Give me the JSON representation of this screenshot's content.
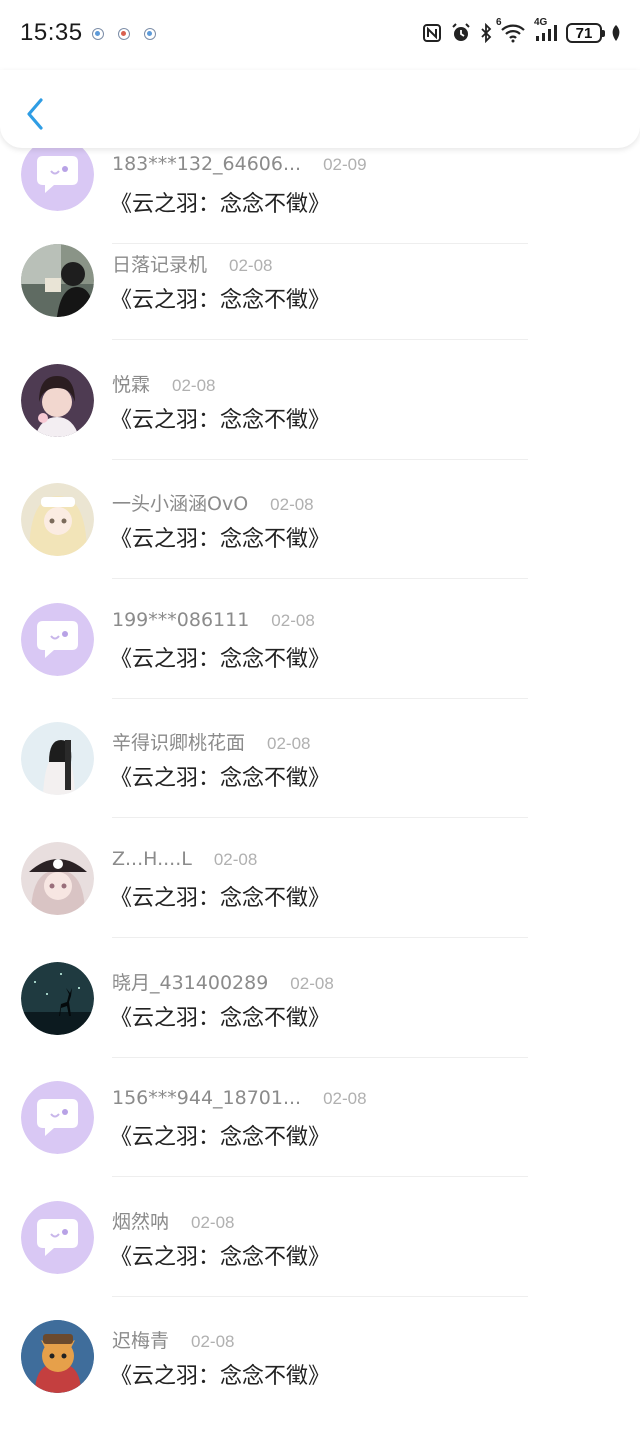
{
  "status_bar": {
    "time": "15:35",
    "network_label": "4G",
    "wifi_badge": "6",
    "battery": "71"
  },
  "header": {
    "back_icon": "chevron-left-icon",
    "accent_color": "#2f9de4"
  },
  "comments": [
    {
      "name": "183***132_64606...",
      "date": "02-09",
      "text": "《云之羽：念念不徵》",
      "avatar": "default-bubble"
    },
    {
      "name": "日落记录机",
      "date": "02-08",
      "text": "《云之羽：念念不徵》",
      "avatar": "photo-reading-girl"
    },
    {
      "name": "悦霖",
      "date": "02-08",
      "text": "《云之羽：念念不徵》",
      "avatar": "photo-girl-selfie"
    },
    {
      "name": "一头小涵涵OvO",
      "date": "02-08",
      "text": "《云之羽：念念不徵》",
      "avatar": "anime-blonde-girl"
    },
    {
      "name": "199***086111",
      "date": "02-08",
      "text": "《云之羽：念念不徵》",
      "avatar": "default-bubble"
    },
    {
      "name": "辛得识卿桃花面",
      "date": "02-08",
      "text": "《云之羽：念念不徵》",
      "avatar": "photo-hanfu-girl"
    },
    {
      "name": "Z...H....L",
      "date": "02-08",
      "text": "《云之羽：念念不徵》",
      "avatar": "anime-hat-girl"
    },
    {
      "name": "晓月_431400289",
      "date": "02-08",
      "text": "《云之羽：念念不徵》",
      "avatar": "night-deer-scene"
    },
    {
      "name": "156***944_18701...",
      "date": "02-08",
      "text": "《云之羽：念念不徵》",
      "avatar": "default-bubble"
    },
    {
      "name": "烟然呐",
      "date": "02-08",
      "text": "《云之羽：念念不徵》",
      "avatar": "default-bubble"
    },
    {
      "name": "迟梅青",
      "date": "02-08",
      "text": "《云之羽：念念不徵》",
      "avatar": "cartoon-fox-character"
    }
  ]
}
